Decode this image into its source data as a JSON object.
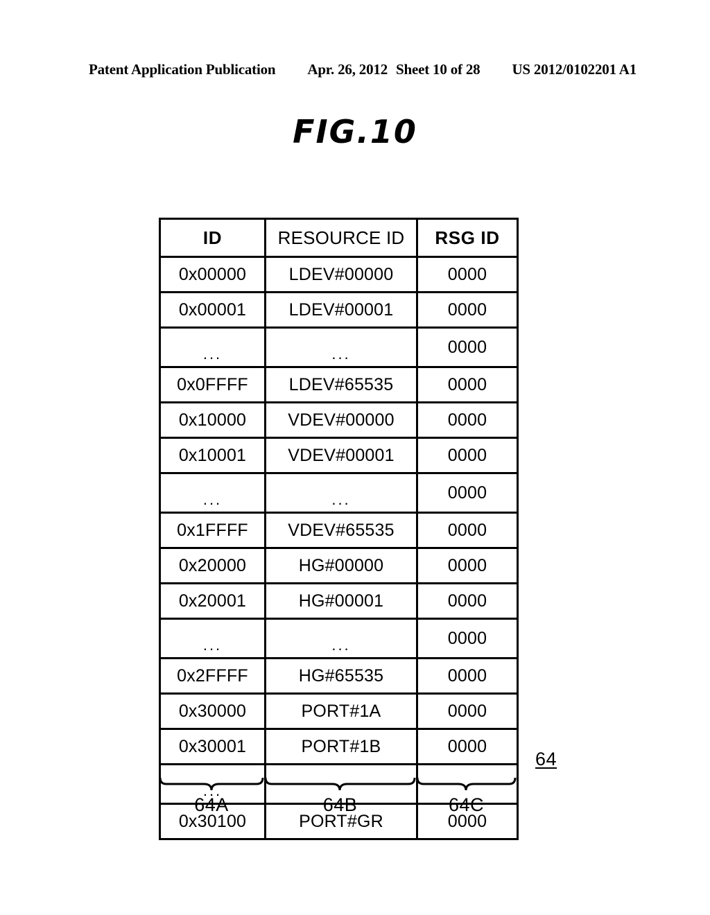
{
  "header": {
    "publication": "Patent Application Publication",
    "date": "Apr. 26, 2012",
    "sheet": "Sheet 10 of 28",
    "patent_number": "US 2012/0102201 A1"
  },
  "figure": {
    "title": "FIG.10",
    "reference_numeral": "64"
  },
  "table": {
    "columns": [
      {
        "label": "ID",
        "bold": true
      },
      {
        "label": "RESOURCE ID",
        "bold": false
      },
      {
        "label": "RSG ID",
        "bold": true
      }
    ],
    "rows": [
      {
        "id": "0x00000",
        "resource_id": "LDEV#00000",
        "rsg_id": "0000"
      },
      {
        "id": "0x00001",
        "resource_id": "LDEV#00001",
        "rsg_id": "0000"
      },
      {
        "id": "...",
        "resource_id": "...",
        "rsg_id": "0000"
      },
      {
        "id": "0x0FFFF",
        "resource_id": "LDEV#65535",
        "rsg_id": "0000"
      },
      {
        "id": "0x10000",
        "resource_id": "VDEV#00000",
        "rsg_id": "0000"
      },
      {
        "id": "0x10001",
        "resource_id": "VDEV#00001",
        "rsg_id": "0000"
      },
      {
        "id": "...",
        "resource_id": "...",
        "rsg_id": "0000"
      },
      {
        "id": "0x1FFFF",
        "resource_id": "VDEV#65535",
        "rsg_id": "0000"
      },
      {
        "id": "0x20000",
        "resource_id": "HG#00000",
        "rsg_id": "0000"
      },
      {
        "id": "0x20001",
        "resource_id": "HG#00001",
        "rsg_id": "0000"
      },
      {
        "id": "...",
        "resource_id": "...",
        "rsg_id": "0000"
      },
      {
        "id": "0x2FFFF",
        "resource_id": "HG#65535",
        "rsg_id": "0000"
      },
      {
        "id": "0x30000",
        "resource_id": "PORT#1A",
        "rsg_id": "0000"
      },
      {
        "id": "0x30001",
        "resource_id": "PORT#1B",
        "rsg_id": "0000"
      },
      {
        "id": "...",
        "resource_id": "",
        "rsg_id": ""
      },
      {
        "id": "0x30100",
        "resource_id": "PORT#GR",
        "rsg_id": "0000"
      }
    ]
  },
  "callouts": [
    {
      "label": "64A"
    },
    {
      "label": "64B"
    },
    {
      "label": "64C"
    }
  ]
}
